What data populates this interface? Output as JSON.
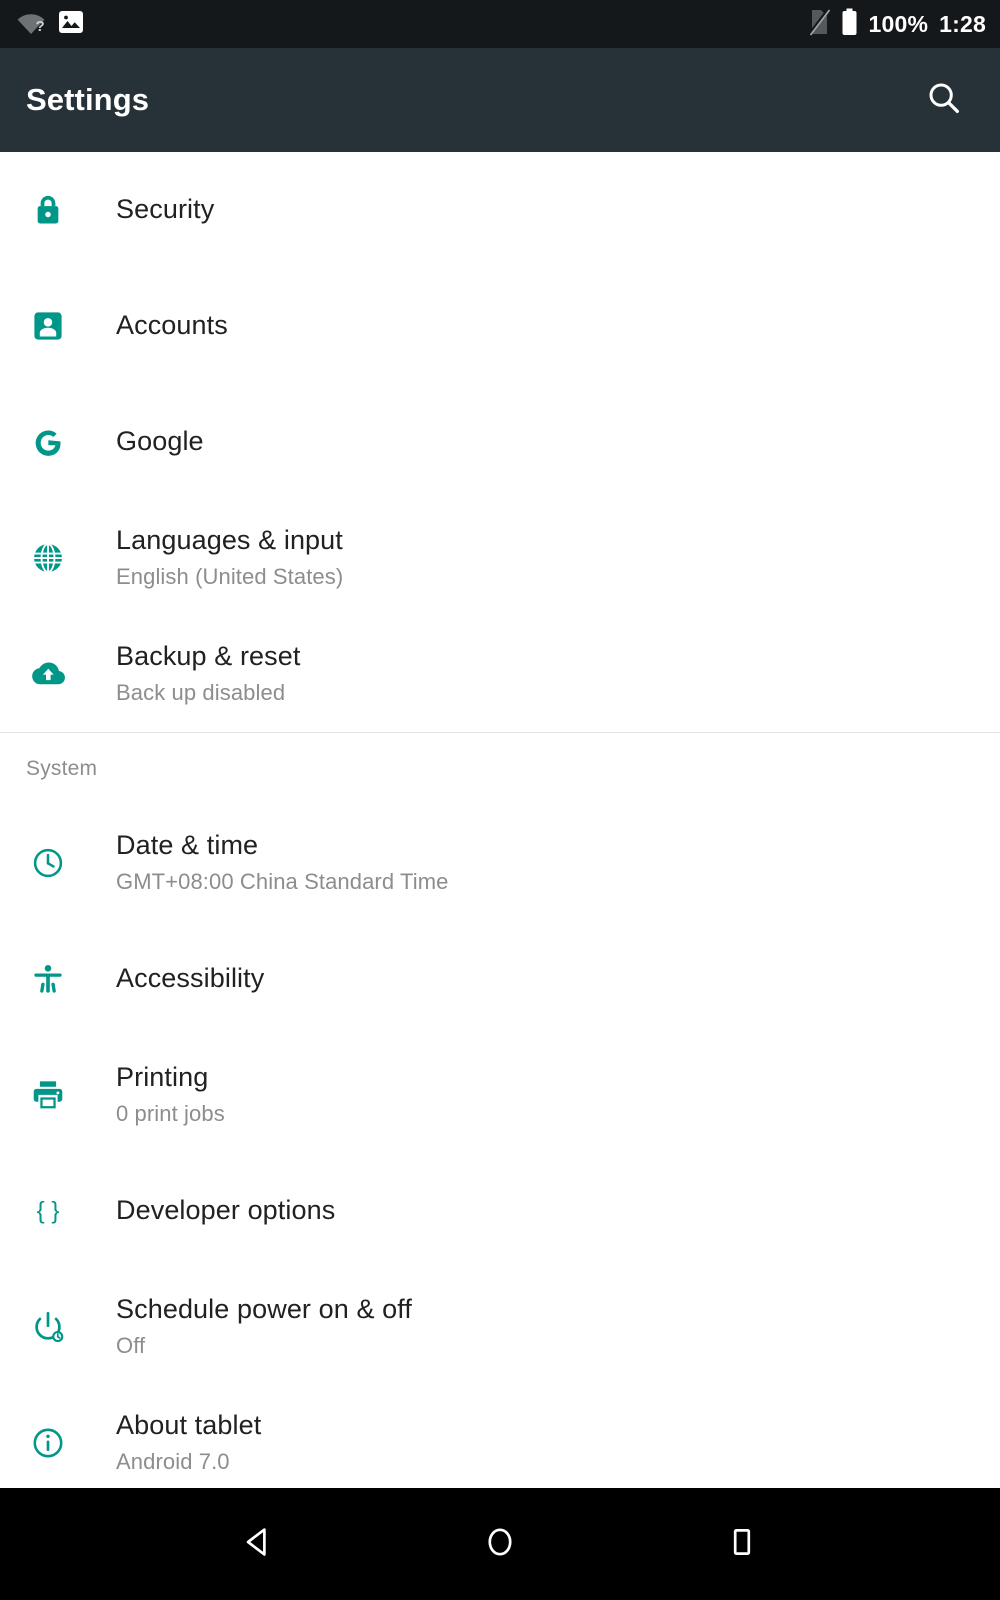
{
  "status_bar": {
    "wifi_icon": "wifi-question-icon",
    "screenshot_icon": "screenshot-image-icon",
    "sim_icon": "sim-card-off-icon",
    "battery_icon": "battery-full-icon",
    "battery_percent": "100%",
    "clock": "1:28"
  },
  "app_bar": {
    "title": "Settings",
    "search_icon": "search-icon"
  },
  "colors": {
    "accent_teal": "#009688",
    "app_bar_bg": "#263238",
    "status_bar_bg": "#14181a",
    "nav_bar_bg": "#000000",
    "title_text": "#212121",
    "subtitle_text": "#8d8d8d",
    "divider": "#e4e4e4"
  },
  "list": [
    {
      "kind": "row",
      "icon": "lock-icon",
      "title": "Security",
      "subtitle": ""
    },
    {
      "kind": "row",
      "icon": "account-box-icon",
      "title": "Accounts",
      "subtitle": ""
    },
    {
      "kind": "row",
      "icon": "google-g-icon",
      "title": "Google",
      "subtitle": ""
    },
    {
      "kind": "row",
      "icon": "globe-icon",
      "title": "Languages & input",
      "subtitle": "English (United States)"
    },
    {
      "kind": "row",
      "icon": "cloud-upload-icon",
      "title": "Backup & reset",
      "subtitle": "Back up disabled"
    },
    {
      "kind": "divider"
    },
    {
      "kind": "section",
      "label": "System"
    },
    {
      "kind": "row",
      "icon": "clock-icon",
      "title": "Date & time",
      "subtitle": "GMT+08:00 China Standard Time"
    },
    {
      "kind": "row",
      "icon": "accessibility-icon",
      "title": "Accessibility",
      "subtitle": ""
    },
    {
      "kind": "row",
      "icon": "printer-icon",
      "title": "Printing",
      "subtitle": "0 print jobs"
    },
    {
      "kind": "row",
      "icon": "braces-icon",
      "title": "Developer options",
      "subtitle": ""
    },
    {
      "kind": "row",
      "icon": "power-schedule-icon",
      "title": "Schedule power on & off",
      "subtitle": "Off"
    },
    {
      "kind": "row",
      "icon": "info-circle-icon",
      "title": "About tablet",
      "subtitle": "Android 7.0"
    }
  ],
  "nav_bar": {
    "back": "back-triangle-icon",
    "home": "home-circle-icon",
    "recents": "recents-square-icon"
  }
}
